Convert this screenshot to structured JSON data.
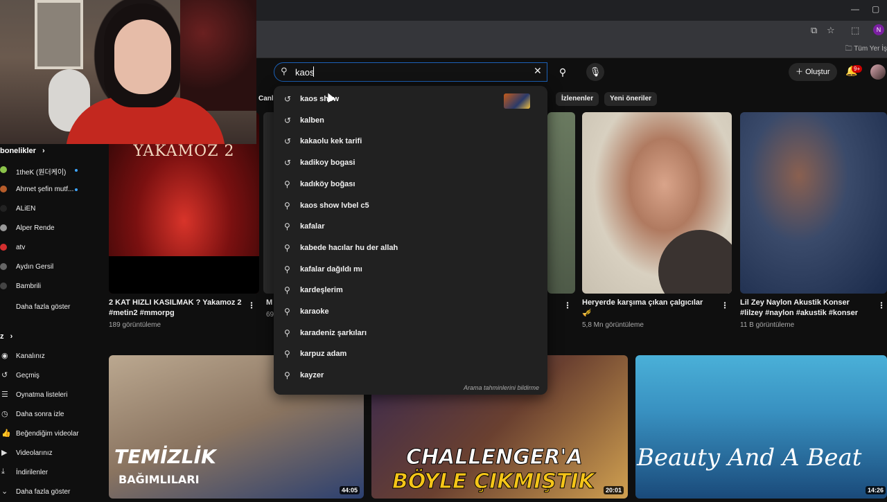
{
  "browser": {
    "bookmarks_all": "Tüm Yer İş",
    "profile_initial": "N"
  },
  "header": {
    "search_value": "kaos",
    "create_label": "Oluştur",
    "notif_badge": "9+"
  },
  "chips": [
    "Canlı",
    "İzlenenler",
    "Yeni öneriler"
  ],
  "suggestions": [
    {
      "text": "kaos show",
      "icon": "history-icon",
      "thumb": true
    },
    {
      "text": "kalben",
      "icon": "history-icon"
    },
    {
      "text": "kakaolu kek tarifi",
      "icon": "history-icon"
    },
    {
      "text": "kadikoy bogasi",
      "icon": "history-icon"
    },
    {
      "text": "kadıköy boğası",
      "icon": "search-icon"
    },
    {
      "text": "kaos show lvbel c5",
      "icon": "search-icon"
    },
    {
      "text": "kafalar",
      "icon": "search-icon"
    },
    {
      "text": "kabede hacılar hu der allah",
      "icon": "search-icon"
    },
    {
      "text": "kafalar dağıldı mı",
      "icon": "search-icon"
    },
    {
      "text": "kardeşlerim",
      "icon": "search-icon"
    },
    {
      "text": "karaoke",
      "icon": "search-icon"
    },
    {
      "text": "karadeniz şarkıları",
      "icon": "search-icon"
    },
    {
      "text": "karpuz adam",
      "icon": "search-icon"
    },
    {
      "text": "kayzer",
      "icon": "search-icon"
    }
  ],
  "report_predictions": "Arama tahminlerini bildirme",
  "sidebar": {
    "subs_header": "bonelikler",
    "subs": [
      {
        "name": "1theK (원더케이)",
        "color": "#8bc34a",
        "live": true
      },
      {
        "name": "Ahmet şefin mutf...",
        "color": "#b65c2a",
        "live": true
      },
      {
        "name": "ALiEN",
        "color": "#222222"
      },
      {
        "name": "Alper Rende",
        "color": "#999999"
      },
      {
        "name": "atv",
        "color": "#d32f2f"
      },
      {
        "name": "Aydın Gersil",
        "color": "#666666"
      },
      {
        "name": "Bambrili",
        "color": "#444444"
      }
    ],
    "show_more": "Daha fazla göster",
    "you_header": "z",
    "you_items": [
      {
        "name": "Kanalınız",
        "icon": "channel-icon"
      },
      {
        "name": "Geçmiş",
        "icon": "history-icon"
      },
      {
        "name": "Oynatma listeleri",
        "icon": "playlist-icon"
      },
      {
        "name": "Daha sonra izle",
        "icon": "watch-later-icon"
      },
      {
        "name": "Beğendiğim videolar",
        "icon": "like-icon"
      },
      {
        "name": "Videolarınız",
        "icon": "video-icon"
      },
      {
        "name": "İndirilenler",
        "icon": "download-icon"
      },
      {
        "name": "Daha fazla göster",
        "icon": "chevron-down-icon"
      }
    ]
  },
  "videos": [
    {
      "title": "2 KAT HIZLI KASILMAK ? Yakamoz 2 #metin2 #mmorpg",
      "meta": "189 görüntüleme",
      "thumb_text": "YAKAMOZ 2"
    },
    {
      "title": "M",
      "meta": "69"
    },
    {
      "title": "Heryerde karşıma çıkan çalgıcılar 🎺",
      "meta": "5,8 Mn görüntüleme"
    },
    {
      "title": "Lil Zey Naylon Akustik Konser #lilzey #naylon #akustik #konser",
      "meta": "11 B görüntüleme"
    }
  ],
  "row2": [
    {
      "thumb_text_1": "TEMİZLİK",
      "thumb_text_2": "BAĞIMLILARI",
      "duration": "44:05"
    },
    {
      "thumb_text_1": "CHALLENGER'A",
      "thumb_text_2": "BÖYLE ÇIKMIŞTIK",
      "duration": "20:01"
    },
    {
      "thumb_text_1": "Beauty And A Beat",
      "duration": "14:26"
    }
  ]
}
